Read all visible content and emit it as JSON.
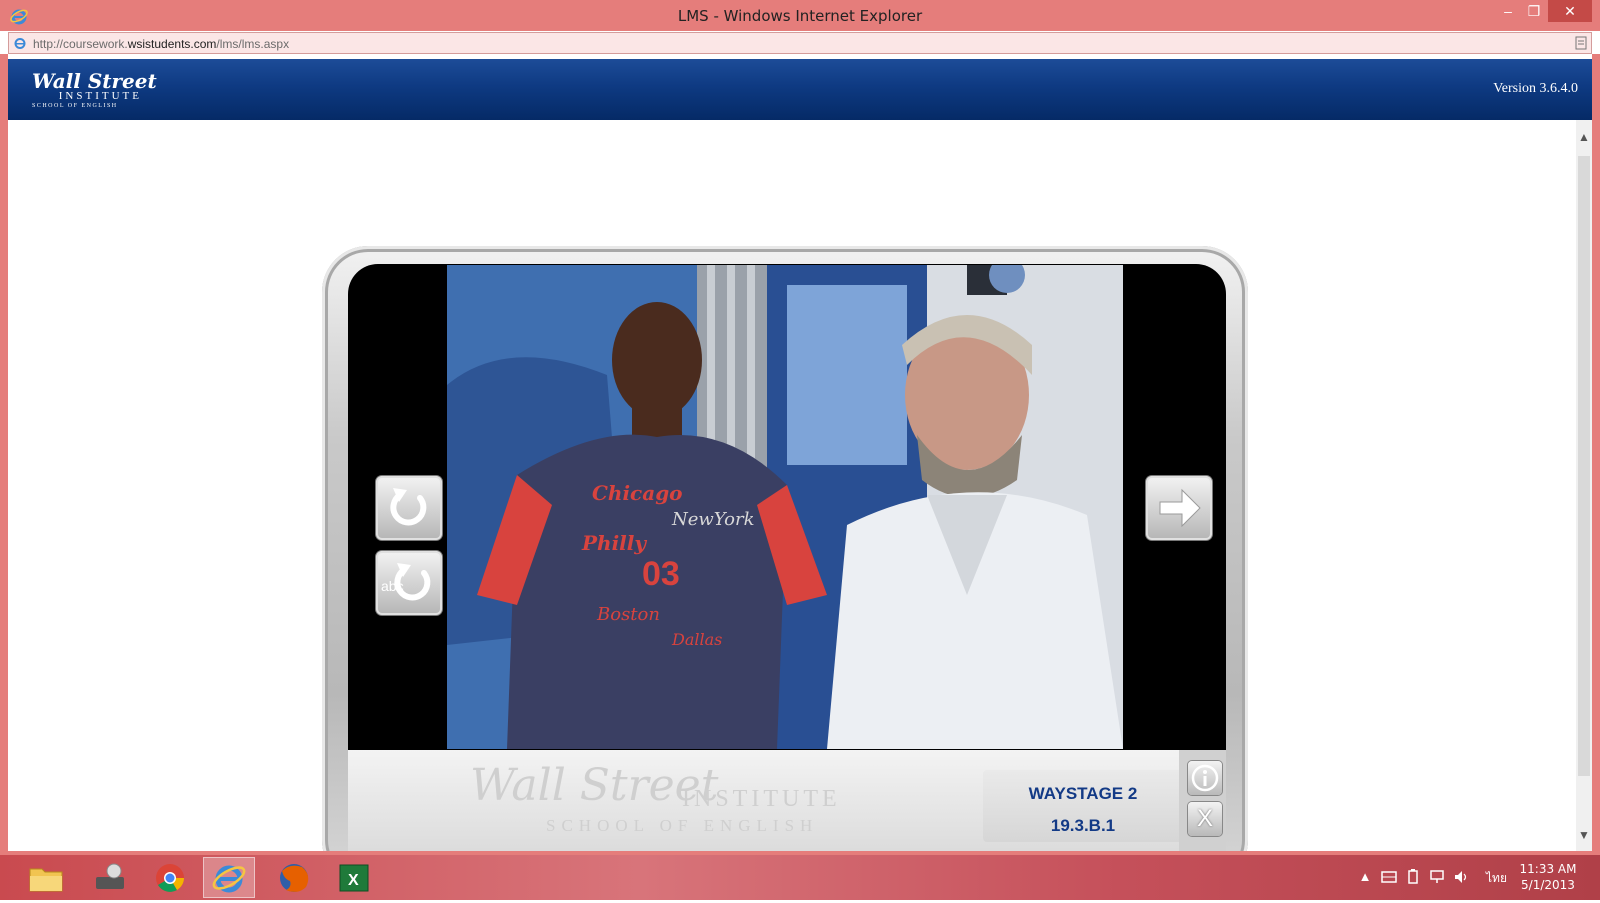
{
  "window": {
    "title": "LMS - Windows Internet Explorer",
    "minimize_glyph": "–",
    "maximize_glyph": "❐",
    "close_glyph": "✕"
  },
  "address": {
    "url_prefix": "http://coursework.",
    "url_domain": "wsistudents.com",
    "url_path": "/lms/lms.aspx"
  },
  "header": {
    "logo_line1": "Wall Street",
    "logo_line2": "INSTITUTE",
    "logo_line3": "SCHOOL OF ENGLISH",
    "version": "Version 3.6.4.0"
  },
  "player": {
    "watermark_line1": "Wall Street",
    "watermark_line2": "INSTITUTE",
    "watermark_line3": "SCHOOL OF ENGLISH",
    "stage": "WAYSTAGE 2",
    "unit": "19.3.B.1",
    "replay_icon": "replay-icon",
    "replay_subtitles_label": "abc",
    "next_icon": "arrow-right-icon",
    "info_icon": "info-icon",
    "close_label": "X"
  },
  "taskbar": {
    "items": [
      "file-explorer",
      "settings-tool",
      "chrome",
      "internet-explorer",
      "firefox",
      "excel"
    ],
    "active": "internet-explorer",
    "tray_arrow": "▲",
    "language": "ไทย",
    "time": "11:33 AM",
    "date": "5/1/2013"
  },
  "colors": {
    "window_frame": "#e57d7b",
    "header_blue": "#0e3a82",
    "stage_text": "#133a86"
  }
}
